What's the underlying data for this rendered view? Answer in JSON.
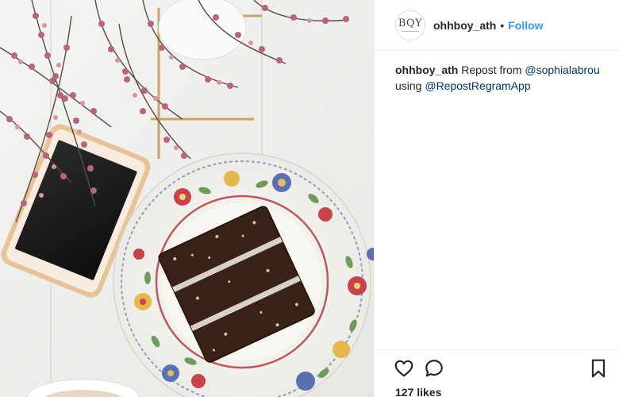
{
  "post": {
    "username": "ohhboy_ath",
    "separator": "•",
    "follow_label": "Follow",
    "avatar_monogram": "BQY",
    "caption": {
      "username": "ohhboy_ath",
      "text_before": " Repost from ",
      "mention_1": "@sophialabrou",
      "text_middle": " using ",
      "mention_2": "@RepostRegramApp"
    },
    "likes_text": "127 likes"
  },
  "icons": {
    "like": "heart-icon",
    "comment": "comment-icon",
    "save": "bookmark-icon"
  },
  "colors": {
    "follow": "#3897f0",
    "mention": "#003569",
    "text": "#262626",
    "divider": "#efefef"
  }
}
